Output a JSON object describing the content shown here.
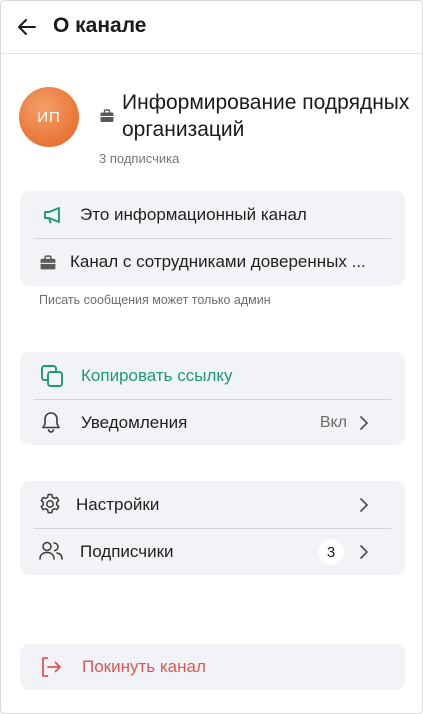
{
  "header": {
    "title": "О канале"
  },
  "channel": {
    "avatar_initials": "ИП",
    "name": "Информирование подрядных организаций",
    "subscribers": "3 подписчика",
    "avatar_color": "#ea7a3c"
  },
  "info_card": {
    "type_label": "Это информационный канал",
    "trusted_label": "Канал с сотрудниками доверенных ..."
  },
  "hint": "Писать сообщения может только админ",
  "actions_card": {
    "copy_link_label": "Копировать ссылку",
    "notifications_label": "Уведомления",
    "notifications_value": "Вкл"
  },
  "settings_card": {
    "settings_label": "Настройки",
    "subscribers_label": "Подписчики",
    "subscribers_count": "3"
  },
  "leave": {
    "label": "Покинуть канал"
  },
  "colors": {
    "accent_green": "#1f9a74",
    "danger_red": "#e25554",
    "card_bg": "#f2f3f6"
  }
}
